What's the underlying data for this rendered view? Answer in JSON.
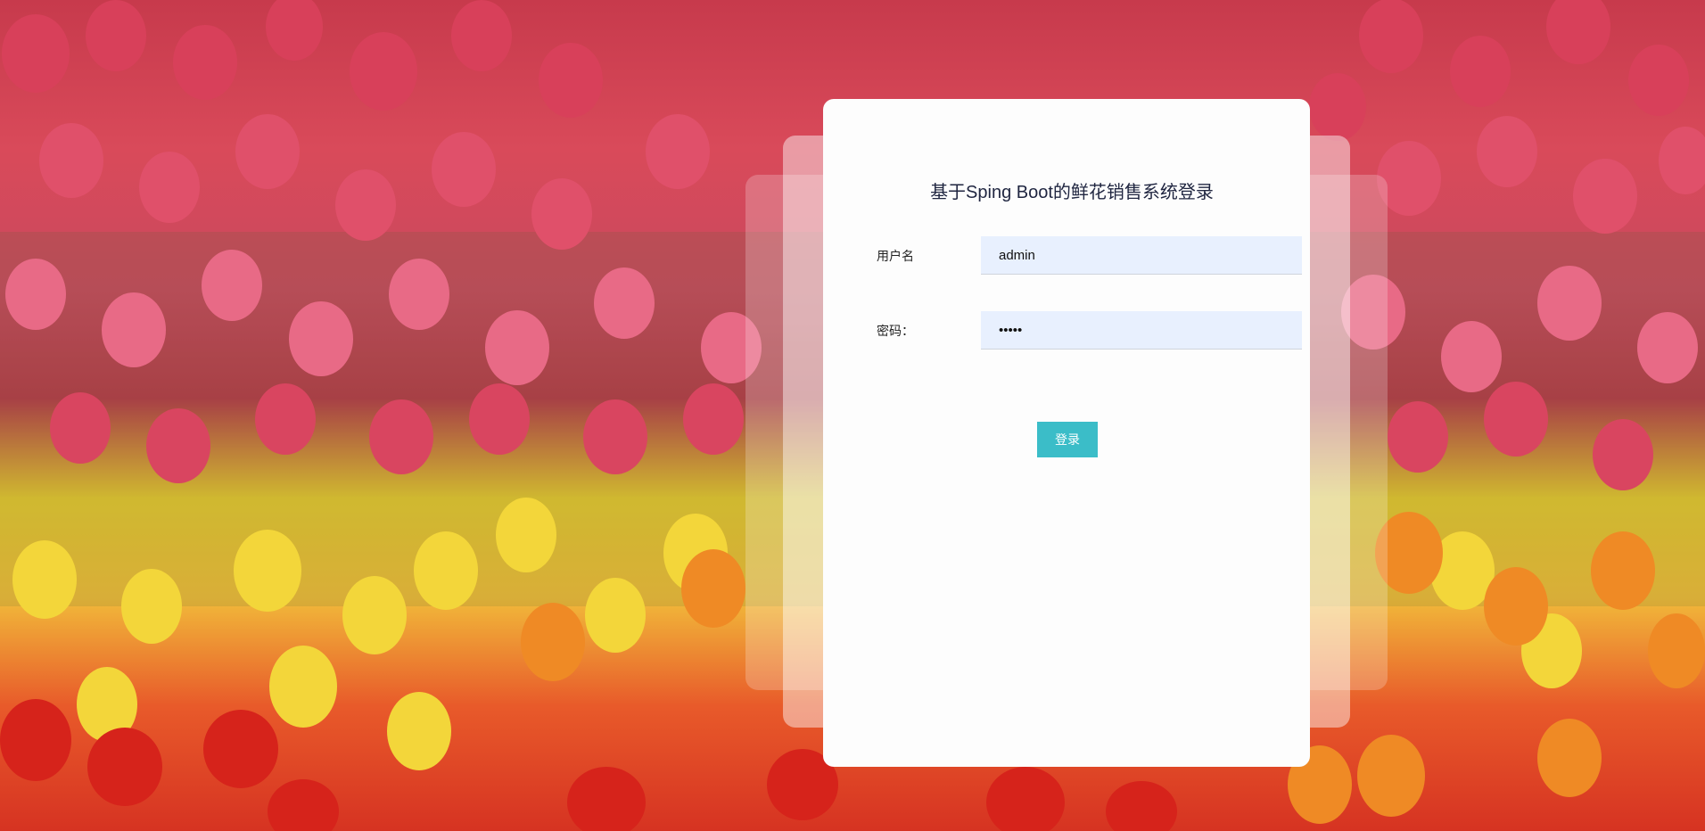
{
  "page": {
    "background_description_colors": {
      "red_tulips": "#d8405a",
      "pink_tulips": "#e26b86",
      "yellow_tulips": "#f3d63a",
      "orange_tulips": "#ef8a25"
    }
  },
  "login": {
    "title": "基于Sping Boot的鲜花销售系统登录",
    "username_label": "用户名",
    "username_value": "admin",
    "password_label": "密码：",
    "password_value": "•••••",
    "submit_label": "登录",
    "accent_color": "#3bbdc8",
    "input_bg_color": "#e8f0fe"
  }
}
